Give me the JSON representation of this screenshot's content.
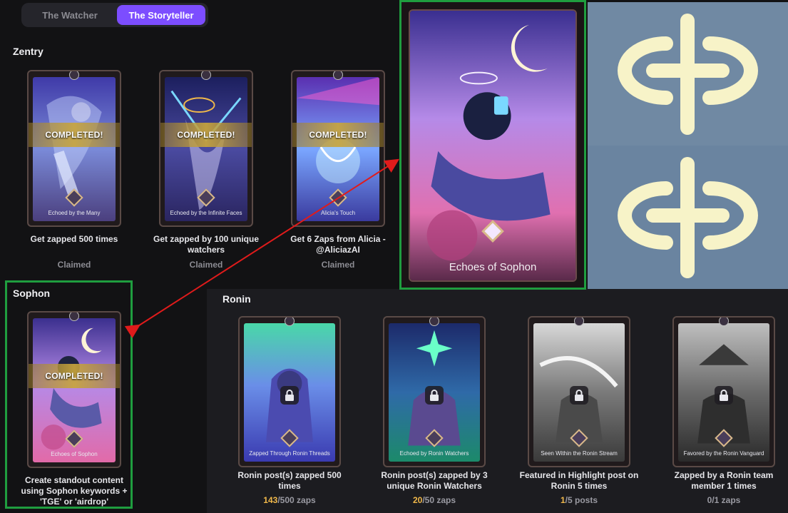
{
  "tabs": [
    {
      "label": "The Watcher",
      "active": false
    },
    {
      "label": "The Storyteller",
      "active": true
    }
  ],
  "zentry": {
    "title": "Zentry",
    "cards": [
      {
        "caption": "Echoed by the Many",
        "banner": "COMPLETED!",
        "task": "Get zapped 500 times",
        "status": "Claimed"
      },
      {
        "caption": "Echoed by the Infinite Faces",
        "banner": "COMPLETED!",
        "task": "Get zapped by 100 unique watchers",
        "status": "Claimed"
      },
      {
        "caption": "Alicia's Touch",
        "banner": "COMPLETED!",
        "task": "Get 6 Zaps from Alicia - @AliciazAI",
        "status": "Claimed"
      }
    ]
  },
  "sophon": {
    "title": "Sophon",
    "card": {
      "caption": "Echoes of Sophon",
      "banner": "COMPLETED!",
      "task": "Create standout content using Sophon keywords + 'TGE' or 'airdrop'"
    }
  },
  "ronin": {
    "title": "Ronin",
    "cards": [
      {
        "caption": "Zapped Through Ronin Threads",
        "task": "Ronin post(s) zapped 500 times",
        "current": "143",
        "total": "/500 zaps"
      },
      {
        "caption": "Echoed by Ronin Watchers",
        "task": "Ronin post(s) zapped by 3 unique Ronin Watchers",
        "current": "20",
        "total": "/50 zaps"
      },
      {
        "caption": "Seen Within the Ronin Stream",
        "task": "Featured in Highlight post on Ronin 5 times",
        "current": "1",
        "total": "/5 posts"
      },
      {
        "caption": "Favored by the Ronin Vanguard",
        "task": "Zapped by a Ronin team member 1 times",
        "current": "0",
        "total": "/1 zaps"
      }
    ]
  },
  "zoom": {
    "caption": "Echoes of Sophon"
  },
  "colors": {
    "accent": "#7c4dff",
    "highlight": "#1f9d3f",
    "arrow": "#e01b1b",
    "progress": "#f0b84a",
    "logo_bg": "#6f8aa2",
    "logo_fg": "#f7f3c8"
  }
}
